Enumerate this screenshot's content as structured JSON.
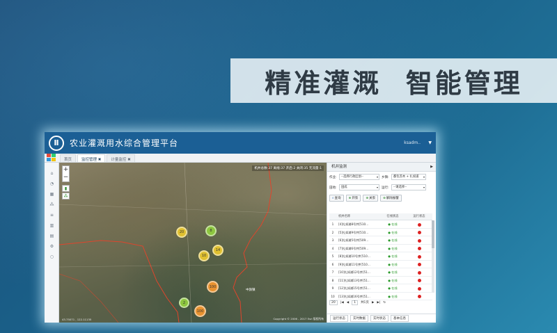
{
  "slogan": "精准灌溉  智能管理",
  "app": {
    "logo_text": "Ⅱ",
    "title": "农业灌溉用水综合管理平台",
    "user": "ksadm..",
    "tabs": [
      {
        "label": "首页",
        "active": false
      },
      {
        "label": "监控管理 ✖",
        "active": true
      },
      {
        "label": "计量监控 ✖",
        "active": false
      }
    ]
  },
  "left_rail": {
    "icons": [
      "home-icon",
      "pie-icon",
      "grid-icon",
      "network-icon",
      "list-icon",
      "bar-chart-icon",
      "table-icon",
      "gear-icon",
      "circle-icon"
    ]
  },
  "map": {
    "stats": "机井总数:37  离线:37  开启:2  关闭:35  无流量:1",
    "zoom_in": "+",
    "zoom_out": "−",
    "clusters": [
      {
        "label": "20",
        "color": "#e0c030"
      },
      {
        "label": "8",
        "color": "#8dc63f"
      },
      {
        "label": "10",
        "color": "#e0c030"
      },
      {
        "label": "14",
        "color": "#e0c030"
      },
      {
        "label": "100",
        "color": "#e8922f"
      },
      {
        "label": "2",
        "color": "#8dc63f"
      },
      {
        "label": "100",
        "color": "#e8922f"
      }
    ],
    "place_label": "中旗镇",
    "copyright": "Copyright © 2006 - 2017 Esri 版权所有",
    "coords": "43.75071 , 122.11135"
  },
  "panel": {
    "title": "机井监测",
    "filter1_label": "作业:",
    "filter1_value": "--选择行政区划--",
    "filter2_label": "乡镇:",
    "filter2_value": "都包苏木 + 扎如浦",
    "filter3_label": "田地:",
    "filter3_value": "田成",
    "filter4_label": "运行:",
    "filter4_value": "--请选择--",
    "buttons": [
      "查询",
      "开泵",
      "关泵",
      "解除报警"
    ],
    "columns": [
      "",
      "机井名称",
      "在线状态",
      "运行状态"
    ],
    "rows": [
      {
        "idx": "1",
        "name": "[4]扎如浦8号井[510...",
        "online": "在线"
      },
      {
        "idx": "2",
        "name": "[5]扎如浦9号井[510...",
        "online": "在线"
      },
      {
        "idx": "3",
        "name": "[6]扎如浦5号井[509...",
        "online": "在线"
      },
      {
        "idx": "4",
        "name": "[7]扎如浦6号井[509...",
        "online": "在线"
      },
      {
        "idx": "5",
        "name": "[8]扎如浦10号井[510...",
        "online": "在线"
      },
      {
        "idx": "6",
        "name": "[9]扎如浦11号井[510...",
        "online": "在线"
      },
      {
        "idx": "7",
        "name": "[10]扎如浦12号井[51...",
        "online": "在线"
      },
      {
        "idx": "8",
        "name": "[11]扎如浦13号井[51...",
        "online": "在线"
      },
      {
        "idx": "9",
        "name": "[12]扎如浦15号井[51...",
        "online": "在线"
      },
      {
        "idx": "10",
        "name": "[13]扎如浦16号井[51...",
        "online": "在线"
      }
    ],
    "pager_size": "20",
    "pager_page": "1",
    "pager_total": "共1页",
    "bottom_tabs": [
      "运行状态",
      "实时数据",
      "实时状态",
      "基本信息"
    ]
  }
}
